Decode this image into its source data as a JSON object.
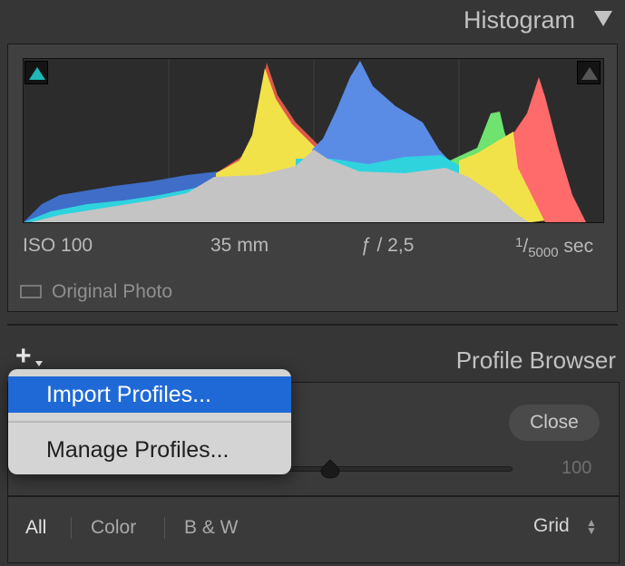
{
  "histogram": {
    "title": "Histogram",
    "exif": {
      "iso": "ISO 100",
      "focal_length": "35 mm",
      "aperture": "ƒ / 2,5",
      "shutter_num": "1",
      "shutter_den": "5000",
      "shutter_unit": "sec"
    },
    "original_photo_label": "Original Photo",
    "channel_colors": {
      "red": "#ff6a6a",
      "green": "#6fe26f",
      "blue": "#4f86e0",
      "yellow": "#f2e24a",
      "cyan": "#2fd3dd",
      "neutral": "#c4c4c4",
      "shadow_clip": "#1fb7b7"
    }
  },
  "profile_browser": {
    "title": "Profile Browser",
    "close_label": "Close",
    "amount_value": "100",
    "amount_slider_level": 0.24,
    "filters": {
      "all": "All",
      "color": "Color",
      "bw": "B & W"
    },
    "view_mode": "Grid"
  },
  "add_menu": {
    "plus_glyph": "+",
    "import_label": "Import Profiles...",
    "manage_label": "Manage Profiles..."
  },
  "accent_color": "#1f69d6"
}
